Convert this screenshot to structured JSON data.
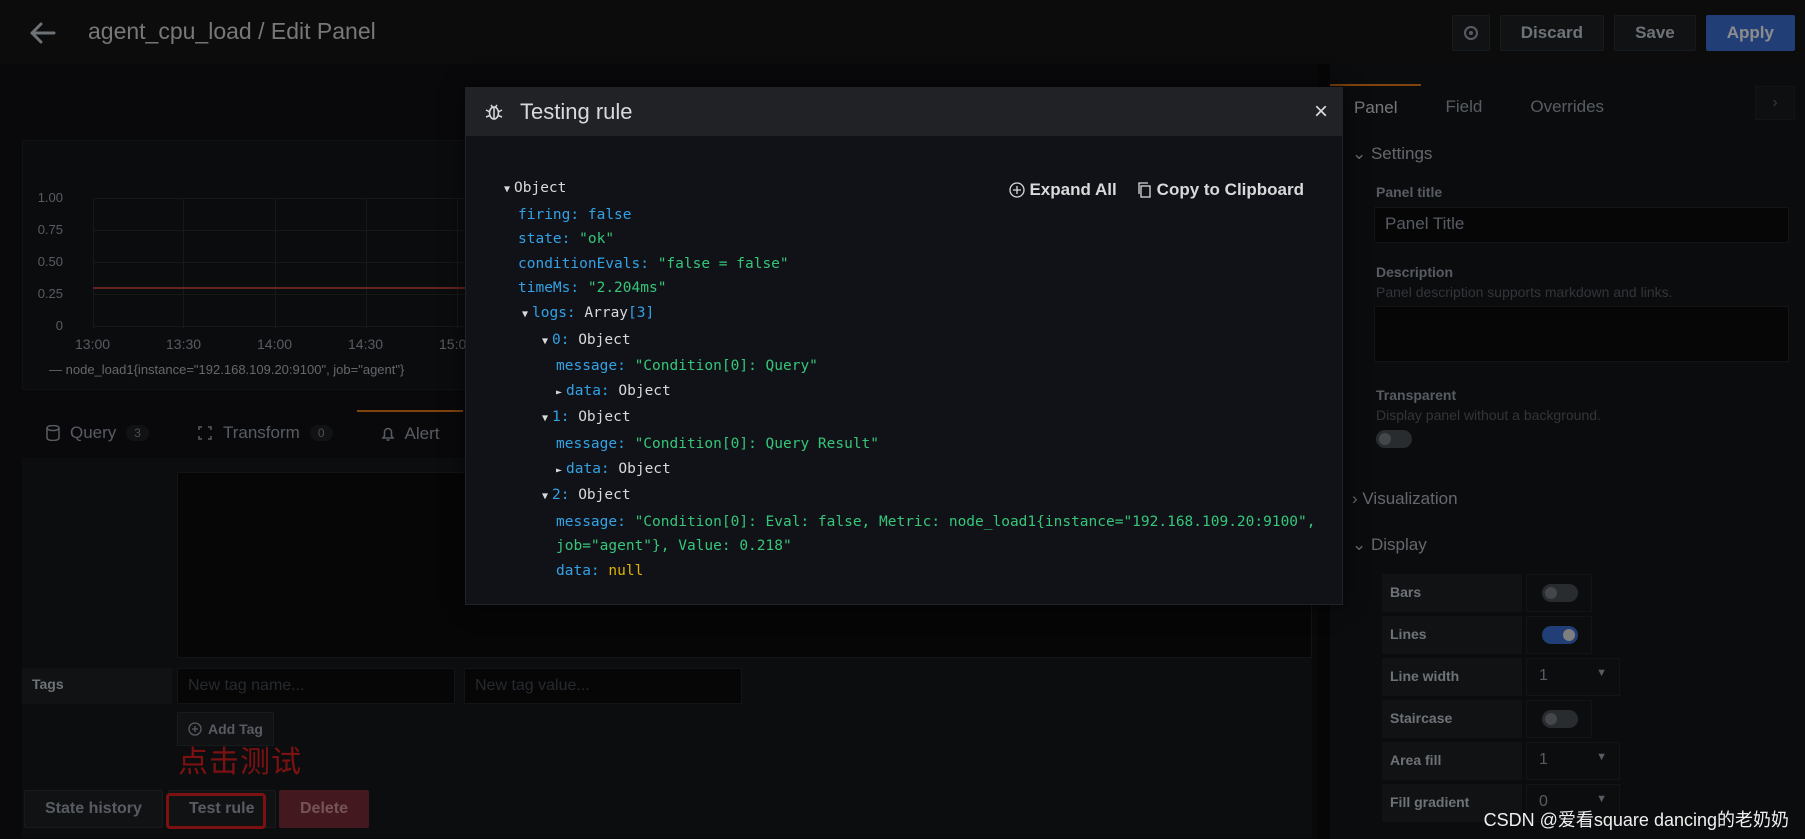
{
  "header": {
    "title": "agent_cpu_load / Edit Panel",
    "discard": "Discard",
    "save": "Save",
    "apply": "Apply"
  },
  "graph": {
    "y_ticks": [
      "1.00",
      "0.75",
      "0.50",
      "0.25",
      "0"
    ],
    "x_ticks": [
      "13:00",
      "13:30",
      "14:00",
      "14:30",
      "15:0"
    ],
    "legend": "node_load1{instance=\"192.168.109.20:9100\", job=\"agent\"}"
  },
  "query_tabs": [
    {
      "label": "Query",
      "count": "3"
    },
    {
      "label": "Transform",
      "count": "0"
    },
    {
      "label": "Alert",
      "count": ""
    }
  ],
  "alert": {
    "tags_label": "Tags",
    "tag_name_placeholder": "New tag name...",
    "tag_value_placeholder": "New tag value...",
    "add_tag": "Add Tag",
    "annotation": "点击测试",
    "state_history": "State history",
    "test_rule": "Test rule",
    "delete": "Delete"
  },
  "right_panel": {
    "tabs": [
      "Panel",
      "Field",
      "Overrides"
    ],
    "settings": "Settings",
    "panel_title_label": "Panel title",
    "panel_title_value": "Panel Title",
    "description_label": "Description",
    "description_help": "Panel description supports markdown and links.",
    "transparent_label": "Transparent",
    "transparent_help": "Display panel without a background.",
    "visualization": "Visualization",
    "display": "Display",
    "options": {
      "bars": "Bars",
      "lines": "Lines",
      "line_width": "Line width",
      "line_width_value": "1",
      "staircase": "Staircase",
      "area_fill": "Area fill",
      "area_fill_value": "1",
      "fill_gradient": "Fill gradient",
      "fill_gradient_value": "0"
    }
  },
  "modal": {
    "title": "Testing rule",
    "close": "×",
    "expand_all": "Expand All",
    "copy": "Copy to Clipboard",
    "tree": {
      "root": "Object",
      "firing_key": "firing",
      "firing_val": "false",
      "state_key": "state",
      "state_val": "\"ok\"",
      "ce_key": "conditionEvals",
      "ce_val": "\"false = false\"",
      "time_key": "timeMs",
      "time_val": "\"2.204ms\"",
      "logs_key": "logs",
      "logs_type": "Array",
      "logs_len": "[3]",
      "i0": "0",
      "i1": "1",
      "i2": "2",
      "obj": "Object",
      "msg_key": "message",
      "data_key": "data",
      "msg0": "\"Condition[0]: Query\"",
      "msg1": "\"Condition[0]: Query Result\"",
      "msg2a": "\"Condition[0]: Eval: false, Metric: node_load1{instance=\"192.168.109.20:9100\",",
      "msg2b": "job=\"agent\"}, Value: 0.218\"",
      "null": "null"
    }
  },
  "watermark": "CSDN @爱看square dancing的老奶奶"
}
